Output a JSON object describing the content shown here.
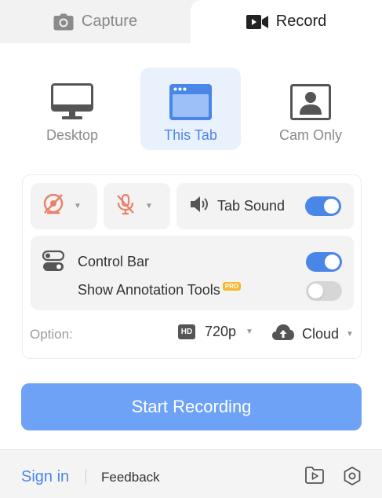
{
  "tabs": {
    "capture": {
      "label": "Capture",
      "icon": "camera-icon"
    },
    "record": {
      "label": "Record",
      "icon": "video-camera-icon"
    }
  },
  "modes": {
    "desktop": {
      "label": "Desktop",
      "icon": "monitor-icon"
    },
    "this_tab": {
      "label": "This Tab",
      "icon": "browser-tab-icon"
    },
    "cam_only": {
      "label": "Cam Only",
      "icon": "portrait-icon"
    }
  },
  "media": {
    "camera": {
      "icon": "camera-off-icon",
      "enabled": false
    },
    "microphone": {
      "icon": "microphone-off-icon",
      "enabled": false
    },
    "tab_sound": {
      "label": "Tab Sound",
      "enabled": true
    }
  },
  "controls": {
    "control_bar": {
      "label": "Control Bar",
      "enabled": true
    },
    "annotation_tools": {
      "label": "Show Annotation Tools",
      "badge": "PRO",
      "enabled": false
    }
  },
  "options": {
    "label": "Option:",
    "resolution_badge": "HD",
    "resolution": "720p",
    "destination": "Cloud"
  },
  "start_button": "Start Recording",
  "footer": {
    "sign_in": "Sign in",
    "feedback": "Feedback"
  },
  "colors": {
    "accent": "#4a86e8",
    "start_button": "#6ea2f7",
    "muted_red": "#e8806b",
    "pro_badge": "#f5b82e"
  }
}
